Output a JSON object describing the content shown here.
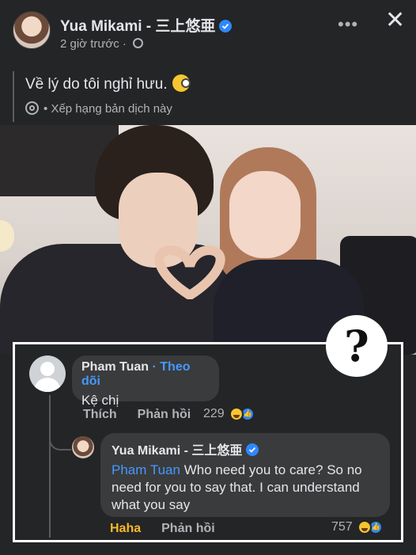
{
  "header": {
    "author": "Yua Mikami - 三上悠亜",
    "timestamp": "2 giờ trước",
    "separator": "·",
    "more_label": "•••",
    "close_label": "✕"
  },
  "post": {
    "text": "Về lý do tôi nghỉ hưu.",
    "translate_separator": "•",
    "translate_label": "Xếp hạng bản dịch này"
  },
  "overlay": {
    "question_mark": "?"
  },
  "comment": {
    "author": "Pham Tuan",
    "dot": "·",
    "follow_label": "Theo dõi",
    "text": "Kệ chị",
    "like_label": "Thích",
    "reply_label": "Phản hồi",
    "reaction_count": "229"
  },
  "reply": {
    "author": "Yua Mikami - 三上悠亜",
    "mention": "Pham Tuan",
    "text": "Who need you to care? So no need for you to say that. I can understand what you say",
    "reaction_label": "Haha",
    "reply_label": "Phản hồi",
    "reaction_count": "757"
  },
  "colors": {
    "background": "#242526",
    "bubble": "#3a3b3c",
    "link": "#4599ff",
    "haha": "#f7b928",
    "verified": "#2d88ff"
  }
}
